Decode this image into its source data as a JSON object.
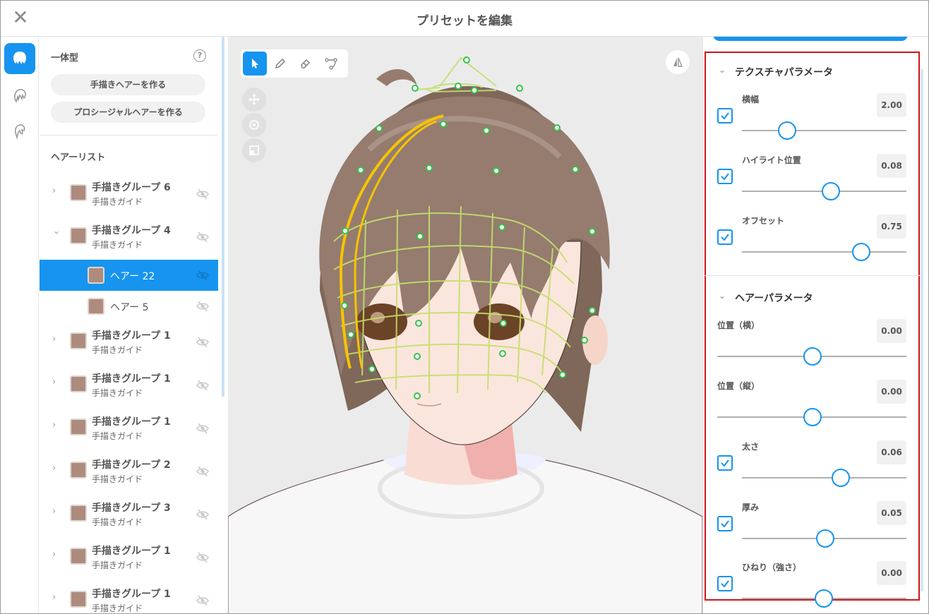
{
  "window": {
    "title": "プリセットを編集"
  },
  "left_panel": {
    "type_label": "一体型",
    "create_hand_drawn": "手描きヘアーを作る",
    "create_procedural": "プロシージャルヘアーを作る",
    "hair_list_label": "ヘアーリスト",
    "items": [
      {
        "title": "手描きグループ 6",
        "subtitle": "手描きガイド",
        "expanded": false
      },
      {
        "title": "手描きグループ 4",
        "subtitle": "手描きガイド",
        "expanded": true
      },
      {
        "title": "ヘアー 22",
        "selected": true
      },
      {
        "title": "ヘアー 5"
      },
      {
        "title": "手描きグループ 1",
        "subtitle": "手描きガイド"
      },
      {
        "title": "手描きグループ 1",
        "subtitle": "手描きガイド"
      },
      {
        "title": "手描きグループ 1",
        "subtitle": "手描きガイド"
      },
      {
        "title": "手描きグループ 2",
        "subtitle": "手描きガイド"
      },
      {
        "title": "手描きグループ 3",
        "subtitle": "手描きガイド"
      },
      {
        "title": "手描きグループ 1",
        "subtitle": "手描きガイド"
      },
      {
        "title": "手描きグループ 1",
        "subtitle": "手描きガイド"
      }
    ],
    "swatch_color": "#ad8c7e"
  },
  "right_panel": {
    "texture_section": {
      "title": "テクスチャパラメータ",
      "params": [
        {
          "label": "横幅",
          "value": "2.00",
          "checked": true,
          "position": 0.28
        },
        {
          "label": "ハイライト位置",
          "value": "0.08",
          "checked": true,
          "position": 0.54
        },
        {
          "label": "オフセット",
          "value": "0.75",
          "checked": true,
          "position": 0.72
        }
      ]
    },
    "hair_section": {
      "title": "ヘアーパラメータ",
      "params": [
        {
          "label": "位置（横）",
          "value": "0.00",
          "checked": false,
          "position": 0.5
        },
        {
          "label": "位置（縦）",
          "value": "0.00",
          "checked": false,
          "position": 0.5
        },
        {
          "label": "太さ",
          "value": "0.06",
          "checked": true,
          "position": 0.59
        },
        {
          "label": "厚み",
          "value": "0.05",
          "checked": true,
          "position": 0.51
        },
        {
          "label": "ひねり（強さ）",
          "value": "0.00",
          "checked": true,
          "position": 0.5
        }
      ]
    }
  },
  "colors": {
    "accent": "#1694ef",
    "highlight_frame": "#d0141a",
    "hair": "#8b7264",
    "guide_curve": "#f6c400",
    "guide_mesh": "#c4df6d"
  },
  "icons": [
    "close-icon",
    "hair-preset-icon",
    "head-hair-icon",
    "side-hair-icon",
    "help-icon",
    "chevron-right-icon",
    "chevron-down-icon",
    "eye-hidden-icon",
    "select-arrow-icon",
    "pen-icon",
    "eraser-icon",
    "curve-edit-icon",
    "move-icon",
    "rotate-icon",
    "scale-icon",
    "mirror-icon",
    "check-icon"
  ]
}
